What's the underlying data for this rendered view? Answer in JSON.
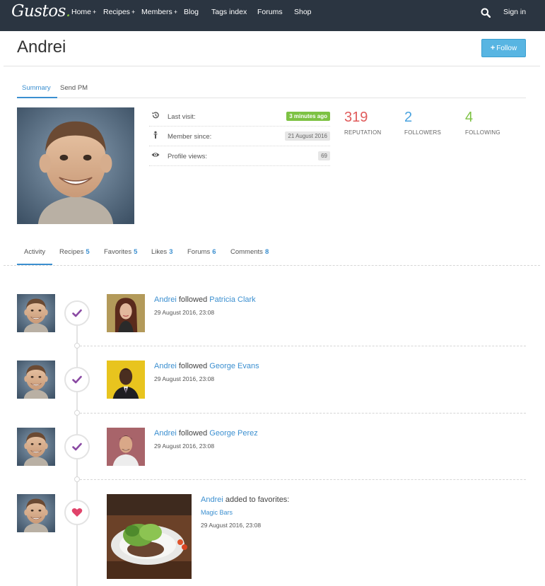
{
  "nav": {
    "logo": "Gustos",
    "logo_dot": ".",
    "items": [
      {
        "label": "Home",
        "plus": "+"
      },
      {
        "label": "Recipes",
        "plus": "+"
      },
      {
        "label": "Members",
        "plus": "+"
      },
      {
        "label": "Blog",
        "plus": ""
      },
      {
        "label": "Tags index",
        "plus": ""
      },
      {
        "label": "Forums",
        "plus": ""
      },
      {
        "label": "Shop",
        "plus": ""
      }
    ],
    "signin": "Sign in"
  },
  "profile": {
    "name": "Andrei",
    "follow_label": "Follow",
    "follow_plus": "+"
  },
  "subtabs": [
    {
      "label": "Summary"
    },
    {
      "label": "Send PM"
    }
  ],
  "info": [
    {
      "label": "Last visit:",
      "value": "3 minutes ago",
      "icon": "history-icon"
    },
    {
      "label": "Member since:",
      "value": "21 August 2016",
      "icon": "person-icon"
    },
    {
      "label": "Profile views:",
      "value": "69",
      "icon": "eye-icon"
    }
  ],
  "stats": [
    {
      "value": "319",
      "label": "REPUTATION",
      "color": "#e05b5b"
    },
    {
      "value": "2",
      "label": "FOLLOWERS",
      "color": "#4aa3df"
    },
    {
      "value": "4",
      "label": "FOLLOWING",
      "color": "#7dc243"
    }
  ],
  "activity_tabs": [
    {
      "label": "Activity",
      "count": ""
    },
    {
      "label": "Recipes",
      "count": "5"
    },
    {
      "label": "Favorites",
      "count": "5"
    },
    {
      "label": "Likes",
      "count": "3"
    },
    {
      "label": "Forums",
      "count": "6"
    },
    {
      "label": "Comments",
      "count": "8"
    }
  ],
  "timeline": [
    {
      "actor": "Andrei",
      "action": "followed",
      "target": "Patricia Clark",
      "date": "29 August 2016, 23:08",
      "icon": "check-icon"
    },
    {
      "actor": "Andrei",
      "action": "followed",
      "target": "George Evans",
      "date": "29 August 2016, 23:08",
      "icon": "check-icon"
    },
    {
      "actor": "Andrei",
      "action": "followed",
      "target": "George Perez",
      "date": "29 August 2016, 23:08",
      "icon": "check-icon"
    },
    {
      "actor": "Andrei",
      "action": "added to favorites:",
      "target": "Magic Bars",
      "date": "29 August 2016, 23:08",
      "icon": "heart-icon"
    }
  ],
  "colors": {
    "navbar": "#2b3541",
    "accent": "#3b8fd0",
    "follow_button": "#58b5e2",
    "timeline_icon": "#8a4aa3",
    "heart": "#e0436a"
  }
}
